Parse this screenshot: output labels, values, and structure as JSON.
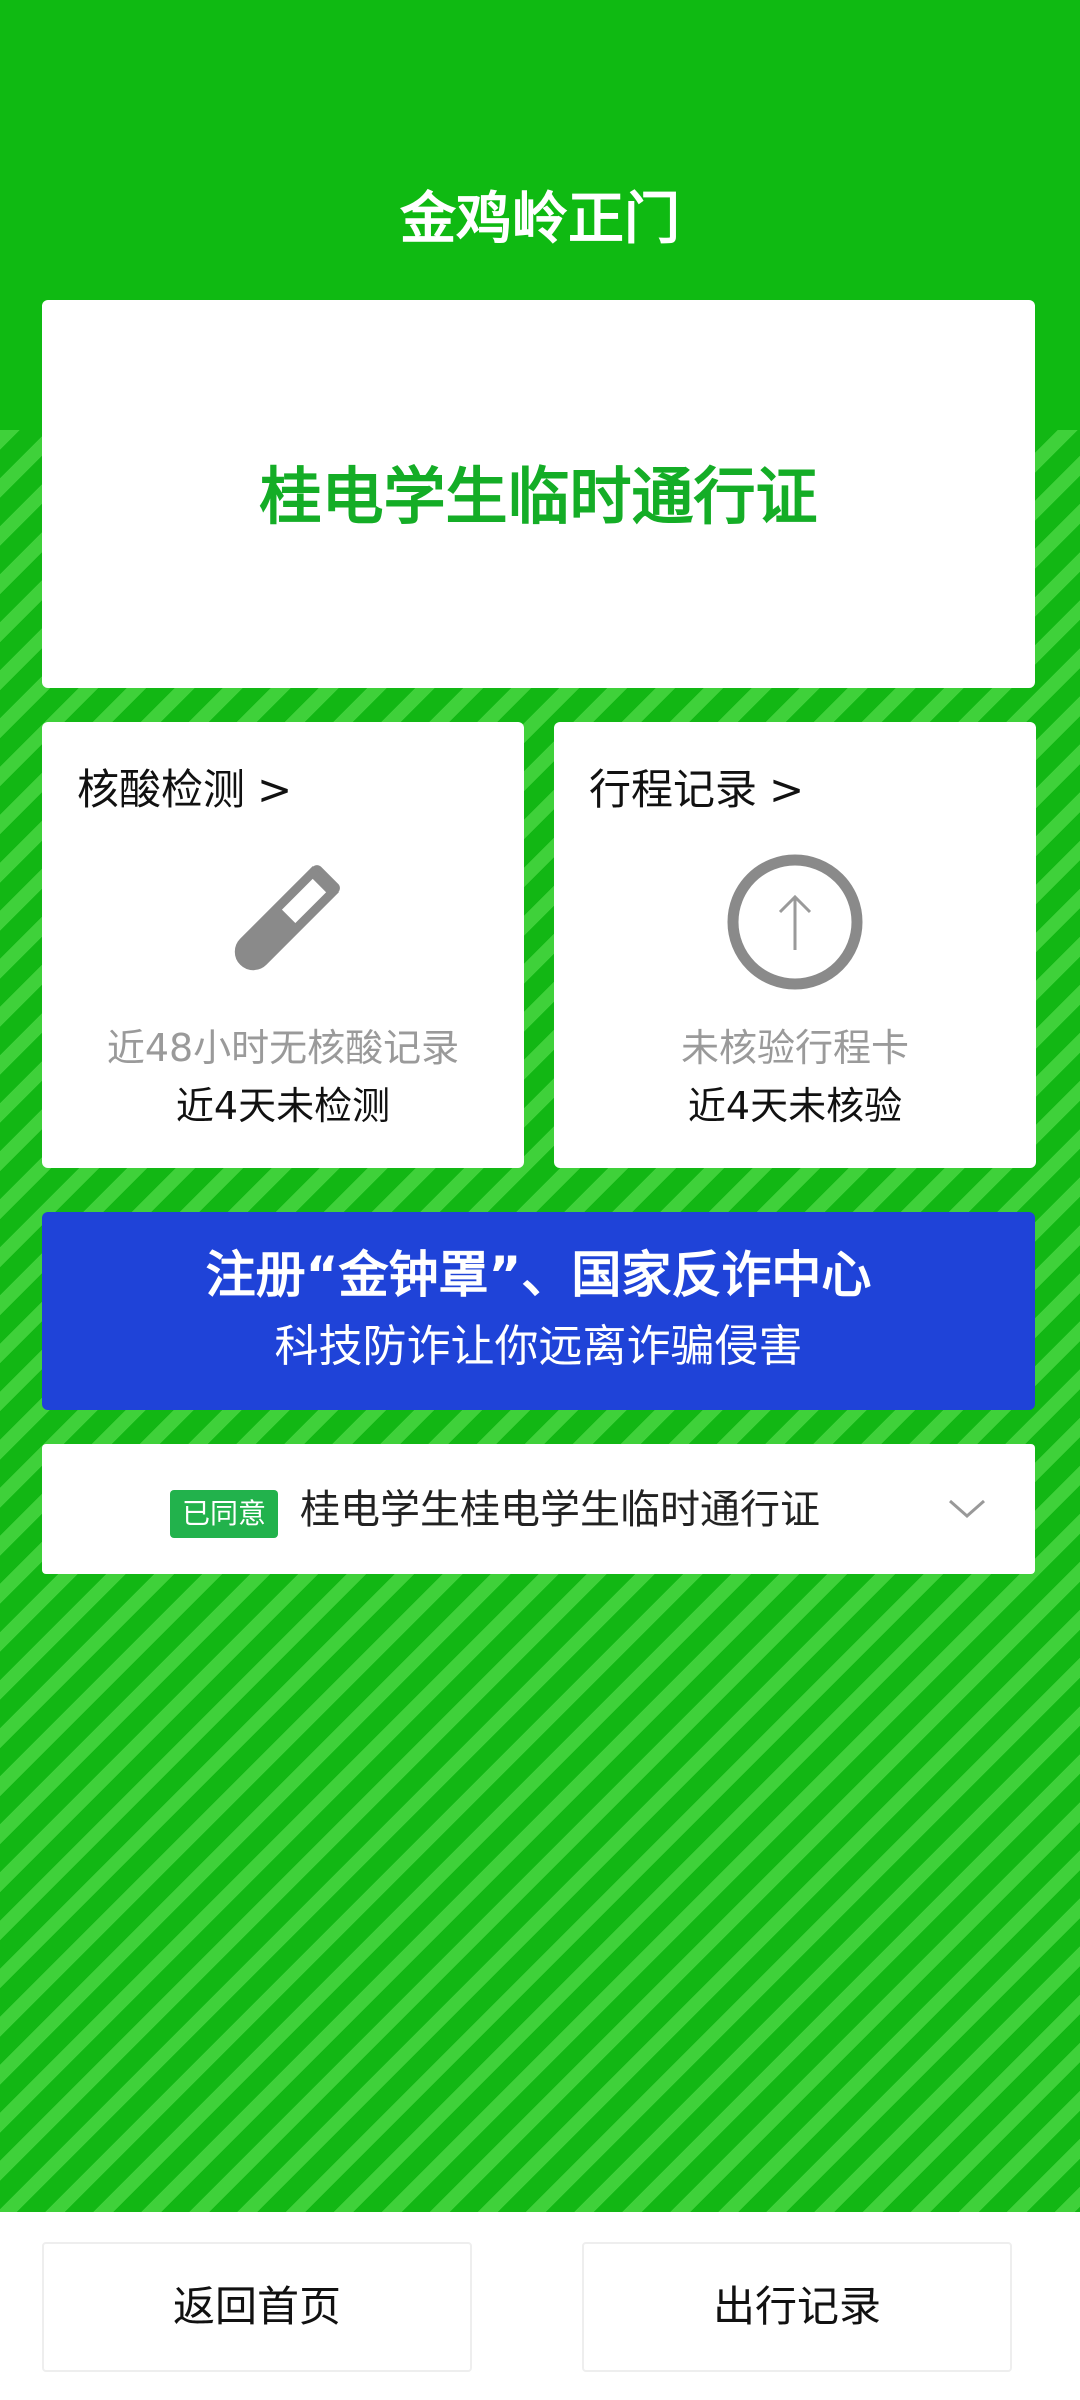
{
  "header": {
    "title": "金鸡岭正门"
  },
  "pass": {
    "title": "桂电学生临时通行证"
  },
  "nucleic": {
    "heading": "核酸检测",
    "arrow": ">",
    "icon": "test-tube-icon",
    "subtitle": "近48小时无核酸记录",
    "status": "近4天未检测"
  },
  "trip": {
    "heading": "行程记录",
    "arrow": ">",
    "icon": "arrow-up-circle-icon",
    "subtitle": "未核验行程卡",
    "status": "近4天未核验"
  },
  "banner": {
    "line1": "注册“金钟罩”、国家反诈中心",
    "line2": "科技防诈让你远离诈骗侵害"
  },
  "consent": {
    "badge": "已同意",
    "text": "桂电学生桂电学生临时通行证"
  },
  "footer": {
    "home_label": "返回首页",
    "record_label": "出行记录"
  },
  "colors": {
    "header_green": "#0fba12",
    "pass_green": "#14ad26",
    "banner_blue": "#1f43d8",
    "badge_green": "#22b24c"
  }
}
